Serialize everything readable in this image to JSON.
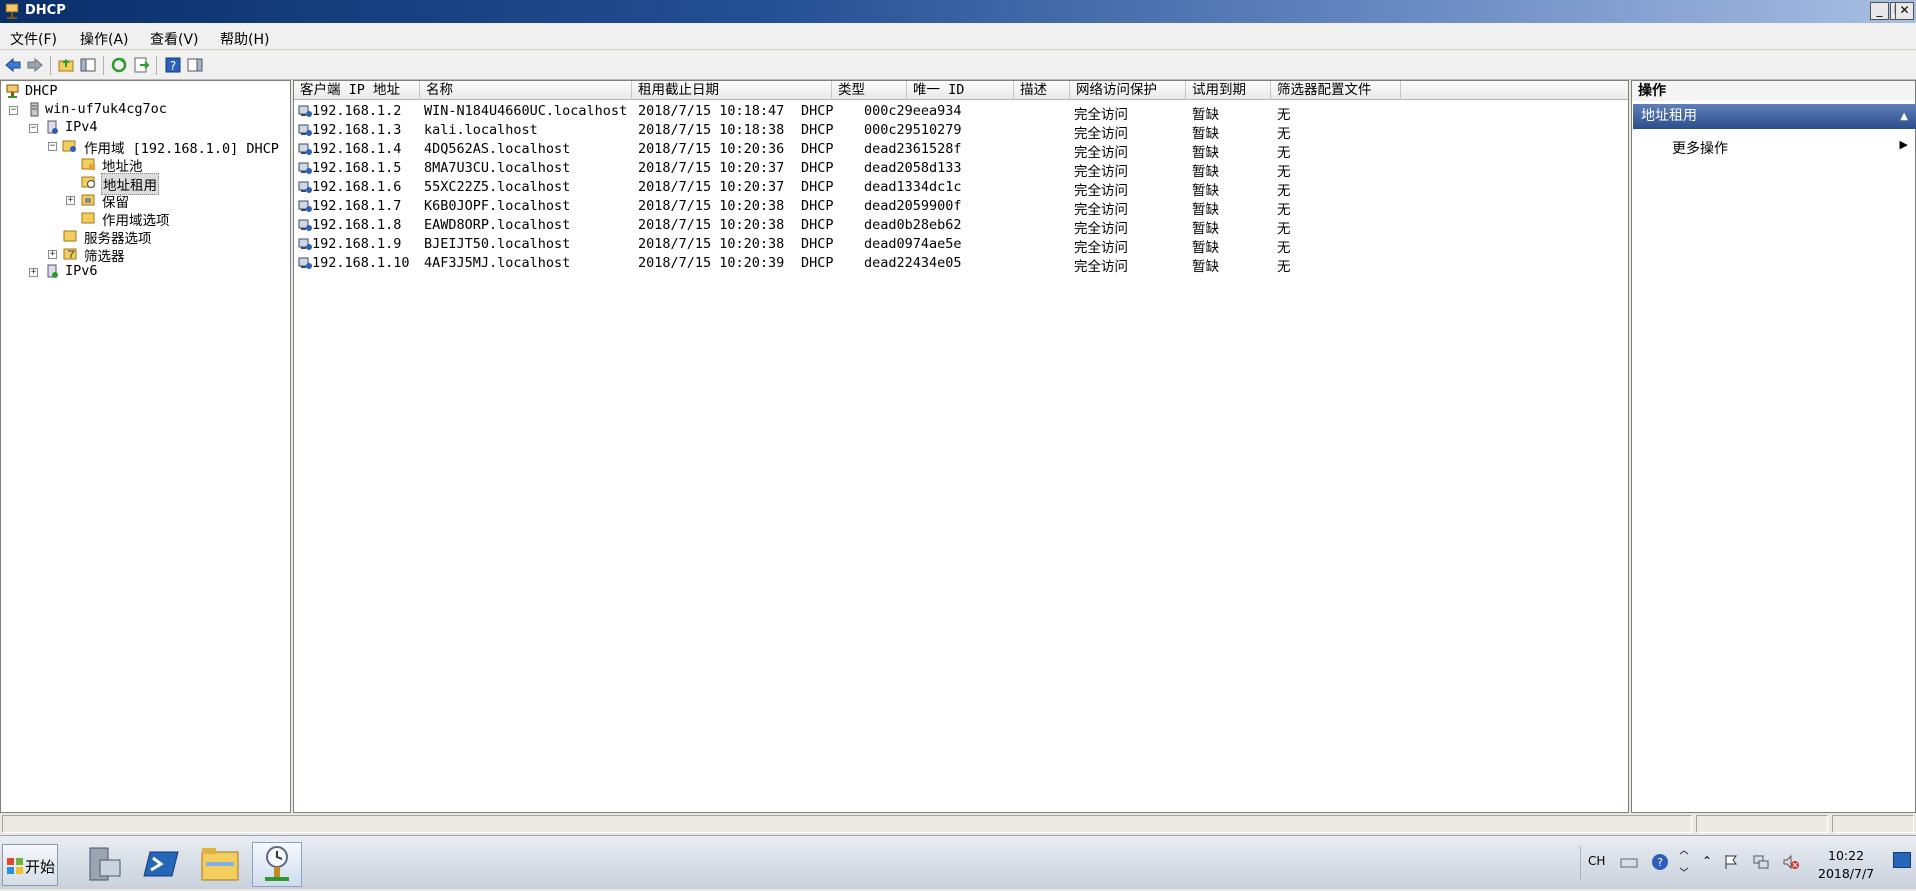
{
  "window": {
    "title": "DHCP",
    "min": "_",
    "restore": "❐",
    "close": "✕"
  },
  "menu": [
    "文件(F)",
    "操作(A)",
    "查看(V)",
    "帮助(H)"
  ],
  "tree": {
    "root": "DHCP",
    "server": "win-uf7uk4cg7oc",
    "ipv4": "IPv4",
    "scope": "作用域 [192.168.1.0] DHCP",
    "pool": "地址池",
    "leases": "地址租用",
    "reservations": "保留",
    "scope_options": "作用域选项",
    "server_options": "服务器选项",
    "filters": "筛选器",
    "ipv6": "IPv6"
  },
  "table": {
    "columns": [
      "客户端 IP 地址",
      "名称",
      "租用截止日期",
      "类型",
      "唯一 ID",
      "描述",
      "网络访问保护",
      "试用到期",
      "筛选器配置文件"
    ],
    "rows": [
      [
        "192.168.1.2",
        "WIN-N184U4660UC.localhost",
        "2018/7/15 10:18:47",
        "DHCP",
        "000c29eea934",
        "",
        "完全访问",
        "暂缺",
        "无"
      ],
      [
        "192.168.1.3",
        "kali.localhost",
        "2018/7/15 10:18:38",
        "DHCP",
        "000c29510279",
        "",
        "完全访问",
        "暂缺",
        "无"
      ],
      [
        "192.168.1.4",
        "4DQ562AS.localhost",
        "2018/7/15 10:20:36",
        "DHCP",
        "dead2361528f",
        "",
        "完全访问",
        "暂缺",
        "无"
      ],
      [
        "192.168.1.5",
        "8MA7U3CU.localhost",
        "2018/7/15 10:20:37",
        "DHCP",
        "dead2058d133",
        "",
        "完全访问",
        "暂缺",
        "无"
      ],
      [
        "192.168.1.6",
        "55XC22Z5.localhost",
        "2018/7/15 10:20:37",
        "DHCP",
        "dead1334dc1c",
        "",
        "完全访问",
        "暂缺",
        "无"
      ],
      [
        "192.168.1.7",
        "K6B0JOPF.localhost",
        "2018/7/15 10:20:38",
        "DHCP",
        "dead2059900f",
        "",
        "完全访问",
        "暂缺",
        "无"
      ],
      [
        "192.168.1.8",
        "EAWD8ORP.localhost",
        "2018/7/15 10:20:38",
        "DHCP",
        "dead0b28eb62",
        "",
        "完全访问",
        "暂缺",
        "无"
      ],
      [
        "192.168.1.9",
        "BJEIJT50.localhost",
        "2018/7/15 10:20:38",
        "DHCP",
        "dead0974ae5e",
        "",
        "完全访问",
        "暂缺",
        "无"
      ],
      [
        "192.168.1.10",
        "4AF3J5MJ.localhost",
        "2018/7/15 10:20:39",
        "DHCP",
        "dead22434e05",
        "",
        "完全访问",
        "暂缺",
        "无"
      ]
    ]
  },
  "actions": {
    "title": "操作",
    "section": "地址租用",
    "more": "更多操作",
    "collapse_arrow": "▲",
    "more_arrow": "▶"
  },
  "taskbar": {
    "start": "开始",
    "lang": "CH",
    "time": "10:22",
    "date": "2018/7/7"
  }
}
